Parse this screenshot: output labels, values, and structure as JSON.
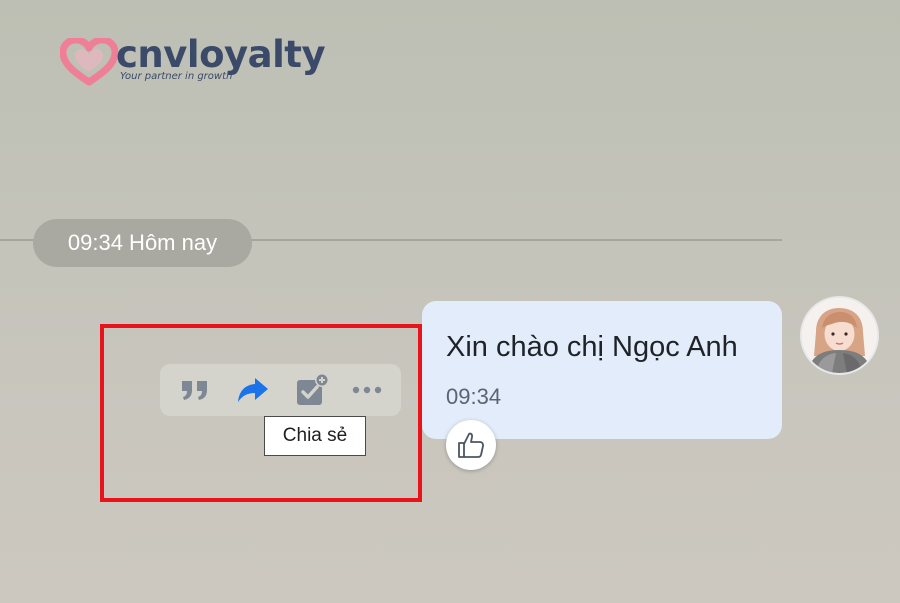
{
  "logo": {
    "wordmark": "cnvloyalty",
    "tagline": "Your partner in growth",
    "heart_color": "#ef7f97",
    "text_color": "#3b4a69"
  },
  "chat": {
    "time_separator": "09:34 Hôm nay",
    "message": {
      "text": "Xin chào chị Ngọc Anh",
      "time": "09:34"
    },
    "avatar_icon": "user-avatar-photo",
    "reaction_icon": "thumbs-up-icon"
  },
  "action_toolbar": {
    "items": [
      {
        "icon": "quote-icon",
        "color": "#7e8794"
      },
      {
        "icon": "share-forward-icon",
        "color": "#1a73e8"
      },
      {
        "icon": "todo-add-icon",
        "color": "#7e8794"
      },
      {
        "icon": "more-icon",
        "color": "#7e8794"
      }
    ]
  },
  "tooltip": {
    "text": "Chia sẻ"
  },
  "highlight_color": "#e8131b"
}
